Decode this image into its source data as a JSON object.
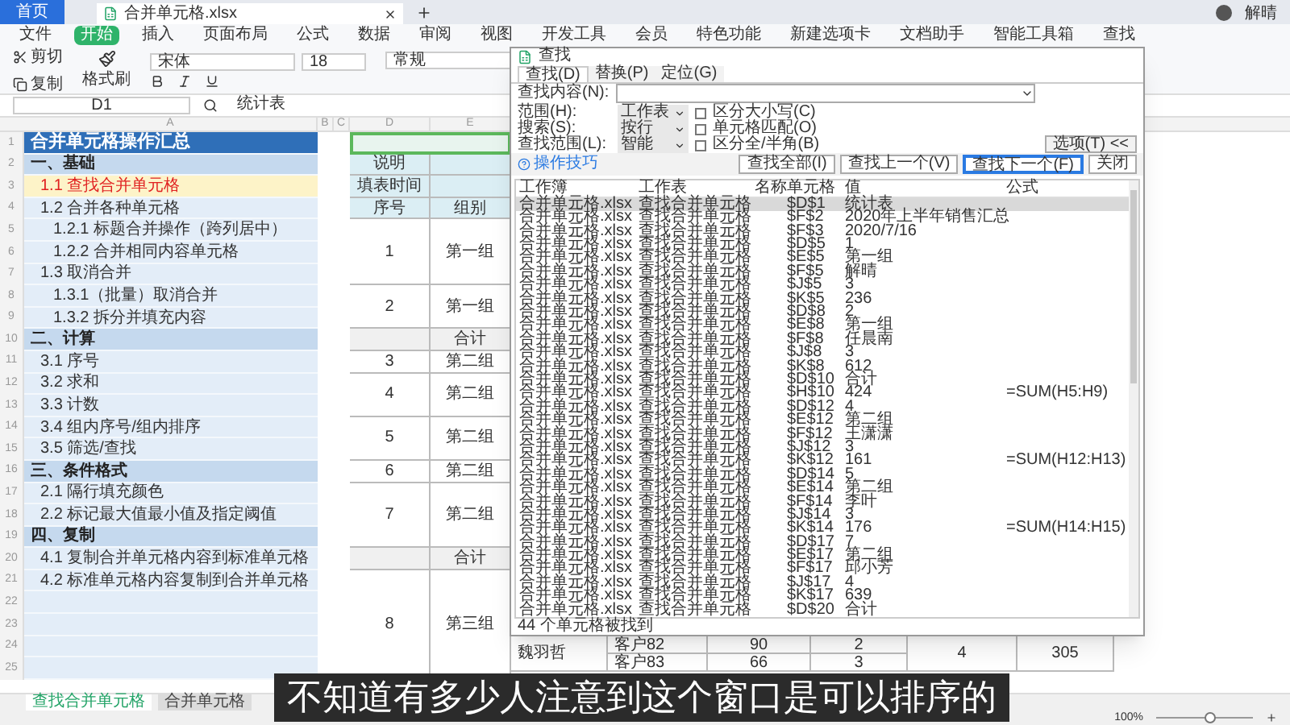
{
  "app": {
    "home_tab": "首页",
    "file_tab": "合并单元格.xlsx",
    "user": "解晴"
  },
  "menu": [
    {
      "label": "文件",
      "selected": false
    },
    {
      "label": "开始",
      "selected": true
    },
    {
      "label": "插入",
      "selected": false
    },
    {
      "label": "页面布局",
      "selected": false
    },
    {
      "label": "公式",
      "selected": false
    },
    {
      "label": "数据",
      "selected": false
    },
    {
      "label": "审阅",
      "selected": false
    },
    {
      "label": "视图",
      "selected": false
    },
    {
      "label": "开发工具",
      "selected": false
    },
    {
      "label": "会员",
      "selected": false
    },
    {
      "label": "特色功能",
      "selected": false
    },
    {
      "label": "新建选项卡",
      "selected": false
    },
    {
      "label": "文档助手",
      "selected": false
    },
    {
      "label": "智能工具箱",
      "selected": false
    },
    {
      "label": "查找",
      "selected": false
    }
  ],
  "ribbon": {
    "cut": "剪切",
    "copy": "复制",
    "format_painter": "格式刷",
    "font": "宋体",
    "size": "18",
    "number_format": "常规"
  },
  "formula_bar": {
    "cell": "D1",
    "content": "统计表"
  },
  "column_letters": [
    "A",
    "B",
    "C",
    "D",
    "E"
  ],
  "row_numbers": [
    "1",
    "2",
    "3",
    "4",
    "5",
    "6",
    "7",
    "8",
    "9",
    "10",
    "11",
    "12",
    "13",
    "14",
    "15",
    "16",
    "17",
    "18",
    "19",
    "20",
    "21",
    "22",
    "23",
    "24",
    "25"
  ],
  "outline": {
    "title": "合并单元格操作汇总",
    "sections": [
      {
        "label": "一、基础",
        "children": [
          {
            "label": "1.1 查找合并单元格",
            "selected": true
          },
          {
            "label": "1.2 合并各种单元格",
            "selected": false,
            "children": [
              {
                "label": "1.2.1 标题合并操作（跨列居中）",
                "selected": false
              },
              {
                "label": "1.2.2 合并相同内容单元格",
                "selected": false
              }
            ]
          },
          {
            "label": "1.3 取消合并",
            "selected": false,
            "children": [
              {
                "label": "1.3.1（批量）取消合并",
                "selected": false
              },
              {
                "label": "1.3.2 拆分并填充内容",
                "selected": false
              }
            ]
          }
        ]
      },
      {
        "label": "二、计算",
        "children": [
          {
            "label": "3.1 序号",
            "selected": false
          },
          {
            "label": "3.2 求和",
            "selected": false
          },
          {
            "label": "3.3 计数",
            "selected": false
          },
          {
            "label": "3.4 组内序号/组内排序",
            "selected": false
          },
          {
            "label": "3.5 筛选/查找",
            "selected": false
          }
        ]
      },
      {
        "label": "三、条件格式",
        "children": [
          {
            "label": "2.1 隔行填充颜色",
            "selected": false
          },
          {
            "label": "2.2 标记最大值最小值及指定阈值",
            "selected": false
          }
        ]
      },
      {
        "label": "四、复制",
        "children": [
          {
            "label": "4.1 复制合并单元格内容到标准单元格",
            "selected": false
          },
          {
            "label": "4.2 标准单元格内容复制到合并单元格",
            "selected": false
          }
        ]
      }
    ]
  },
  "table": {
    "description_label": "说明",
    "date_label": "填表时间",
    "columns": [
      "序号",
      "组别"
    ],
    "rows": [
      {
        "kind": "data",
        "no": "1",
        "group": "第一组"
      },
      {
        "kind": "data",
        "no": "2",
        "group": "第一组"
      },
      {
        "kind": "total",
        "label": "合计"
      },
      {
        "kind": "data",
        "no": "3",
        "group": "第二组"
      },
      {
        "kind": "data",
        "no": "4",
        "group": "第二组"
      },
      {
        "kind": "data",
        "no": "5",
        "group": "第二组"
      },
      {
        "kind": "data",
        "no": "6",
        "group": "第二组"
      },
      {
        "kind": "data",
        "no": "7",
        "group": "第二组"
      },
      {
        "kind": "total",
        "label": "合计"
      },
      {
        "kind": "data",
        "no": "8",
        "group": "第三组"
      }
    ]
  },
  "lower_block": {
    "column_1": "魏羽哲",
    "rows": [
      {
        "column_2": "客户82",
        "column_3": "90",
        "column_4": "2"
      },
      {
        "column_2": "客户83",
        "column_3": "66",
        "column_4": "3"
      }
    ],
    "column_5": "4",
    "column_6": "305"
  },
  "dialog": {
    "title": "查找",
    "tabs": [
      {
        "label": "查找(D)",
        "selected": true
      },
      {
        "label": "替换(P)",
        "selected": false
      },
      {
        "label": "定位(G)",
        "selected": false
      }
    ],
    "find_label": "查找内容(N):",
    "options": [
      {
        "label": "范围(H):",
        "value": "工作表",
        "checkbox": "区分大小写(C)",
        "checked": false
      },
      {
        "label": "搜索(S):",
        "value": "按行",
        "checkbox": "单元格匹配(O)",
        "checked": false
      },
      {
        "label": "查找范围(L):",
        "value": "智能",
        "checkbox": "区分全/半角(B)",
        "checked": false
      }
    ],
    "options_button": "选项(T) <<",
    "tips_link": "操作技巧",
    "buttons": [
      {
        "label": "查找全部(I)",
        "focused": false
      },
      {
        "label": "查找上一个(V)",
        "focused": false
      },
      {
        "label": "查找下一个(F)",
        "focused": true
      },
      {
        "label": "关闭",
        "focused": false
      }
    ],
    "columns": [
      "工作簿",
      "工作表",
      "名称",
      "单元格",
      "值",
      "公式"
    ],
    "results": [
      {
        "workbook": "合并单元格.xlsx",
        "sheet": "查找合并单元格",
        "cell": "$D$1",
        "value": "统计表",
        "selected": true
      },
      {
        "workbook": "合并单元格.xlsx",
        "sheet": "查找合并单元格",
        "cell": "$F$2",
        "value": "2020年上半年销售汇总",
        "selected": false
      },
      {
        "workbook": "合并单元格.xlsx",
        "sheet": "查找合并单元格",
        "cell": "$F$3",
        "value": "2020/7/16",
        "selected": false
      },
      {
        "workbook": "合并单元格.xlsx",
        "sheet": "查找合并单元格",
        "cell": "$D$5",
        "value": "1",
        "selected": false
      },
      {
        "workbook": "合并单元格.xlsx",
        "sheet": "查找合并单元格",
        "cell": "$E$5",
        "value": "第一组",
        "selected": false
      },
      {
        "workbook": "合并单元格.xlsx",
        "sheet": "查找合并单元格",
        "cell": "$F$5",
        "value": "解晴",
        "selected": false
      },
      {
        "workbook": "合并单元格.xlsx",
        "sheet": "查找合并单元格",
        "cell": "$J$5",
        "value": "3",
        "selected": false
      },
      {
        "workbook": "合并单元格.xlsx",
        "sheet": "查找合并单元格",
        "cell": "$K$5",
        "value": "236",
        "selected": false
      },
      {
        "workbook": "合并单元格.xlsx",
        "sheet": "查找合并单元格",
        "cell": "$D$8",
        "value": "2",
        "selected": false
      },
      {
        "workbook": "合并单元格.xlsx",
        "sheet": "查找合并单元格",
        "cell": "$E$8",
        "value": "第一组",
        "selected": false
      },
      {
        "workbook": "合并单元格.xlsx",
        "sheet": "查找合并单元格",
        "cell": "$F$8",
        "value": "任晨南",
        "selected": false
      },
      {
        "workbook": "合并单元格.xlsx",
        "sheet": "查找合并单元格",
        "cell": "$J$8",
        "value": "3",
        "selected": false
      },
      {
        "workbook": "合并单元格.xlsx",
        "sheet": "查找合并单元格",
        "cell": "$K$8",
        "value": "612",
        "selected": false
      },
      {
        "workbook": "合并单元格.xlsx",
        "sheet": "查找合并单元格",
        "cell": "$D$10",
        "value": "合计",
        "selected": false
      },
      {
        "workbook": "合并单元格.xlsx",
        "sheet": "查找合并单元格",
        "cell": "$H$10",
        "value": "424",
        "formula": "=SUM(H5:H9)",
        "selected": false
      },
      {
        "workbook": "合并单元格.xlsx",
        "sheet": "查找合并单元格",
        "cell": "$D$12",
        "value": "4",
        "selected": false
      },
      {
        "workbook": "合并单元格.xlsx",
        "sheet": "查找合并单元格",
        "cell": "$E$12",
        "value": "第二组",
        "selected": false
      },
      {
        "workbook": "合并单元格.xlsx",
        "sheet": "查找合并单元格",
        "cell": "$F$12",
        "value": "王潇潇",
        "selected": false
      },
      {
        "workbook": "合并单元格.xlsx",
        "sheet": "查找合并单元格",
        "cell": "$J$12",
        "value": "3",
        "selected": false
      },
      {
        "workbook": "合并单元格.xlsx",
        "sheet": "查找合并单元格",
        "cell": "$K$12",
        "value": "161",
        "formula": "=SUM(H12:H13)",
        "selected": false
      },
      {
        "workbook": "合并单元格.xlsx",
        "sheet": "查找合并单元格",
        "cell": "$D$14",
        "value": "5",
        "selected": false
      },
      {
        "workbook": "合并单元格.xlsx",
        "sheet": "查找合并单元格",
        "cell": "$E$14",
        "value": "第二组",
        "selected": false
      },
      {
        "workbook": "合并单元格.xlsx",
        "sheet": "查找合并单元格",
        "cell": "$F$14",
        "value": "李叶",
        "selected": false
      },
      {
        "workbook": "合并单元格.xlsx",
        "sheet": "查找合并单元格",
        "cell": "$J$14",
        "value": "3",
        "selected": false
      },
      {
        "workbook": "合并单元格.xlsx",
        "sheet": "查找合并单元格",
        "cell": "$K$14",
        "value": "176",
        "formula": "=SUM(H14:H15)",
        "selected": false
      },
      {
        "workbook": "合并单元格.xlsx",
        "sheet": "查找合并单元格",
        "cell": "$D$17",
        "value": "7",
        "selected": false
      },
      {
        "workbook": "合并单元格.xlsx",
        "sheet": "查找合并单元格",
        "cell": "$E$17",
        "value": "第二组",
        "selected": false
      },
      {
        "workbook": "合并单元格.xlsx",
        "sheet": "查找合并单元格",
        "cell": "$F$17",
        "value": "邱小芳",
        "selected": false
      },
      {
        "workbook": "合并单元格.xlsx",
        "sheet": "查找合并单元格",
        "cell": "$J$17",
        "value": "4",
        "selected": false
      },
      {
        "workbook": "合并单元格.xlsx",
        "sheet": "查找合并单元格",
        "cell": "$K$17",
        "value": "639",
        "selected": false
      },
      {
        "workbook": "合并单元格.xlsx",
        "sheet": "查找合并单元格",
        "cell": "$D$20",
        "value": "合计",
        "selected": false
      }
    ],
    "status": "44 个单元格被找到"
  },
  "sheet_tabs": [
    {
      "label": "查找合并单元格",
      "selected": true
    },
    {
      "label": "合并单元格",
      "selected": false
    }
  ],
  "zoom": "100%",
  "zoom_slider": {
    "level": 0.55
  },
  "subtitle": "不知道有多少人注意到这个窗口是可以排序的"
}
